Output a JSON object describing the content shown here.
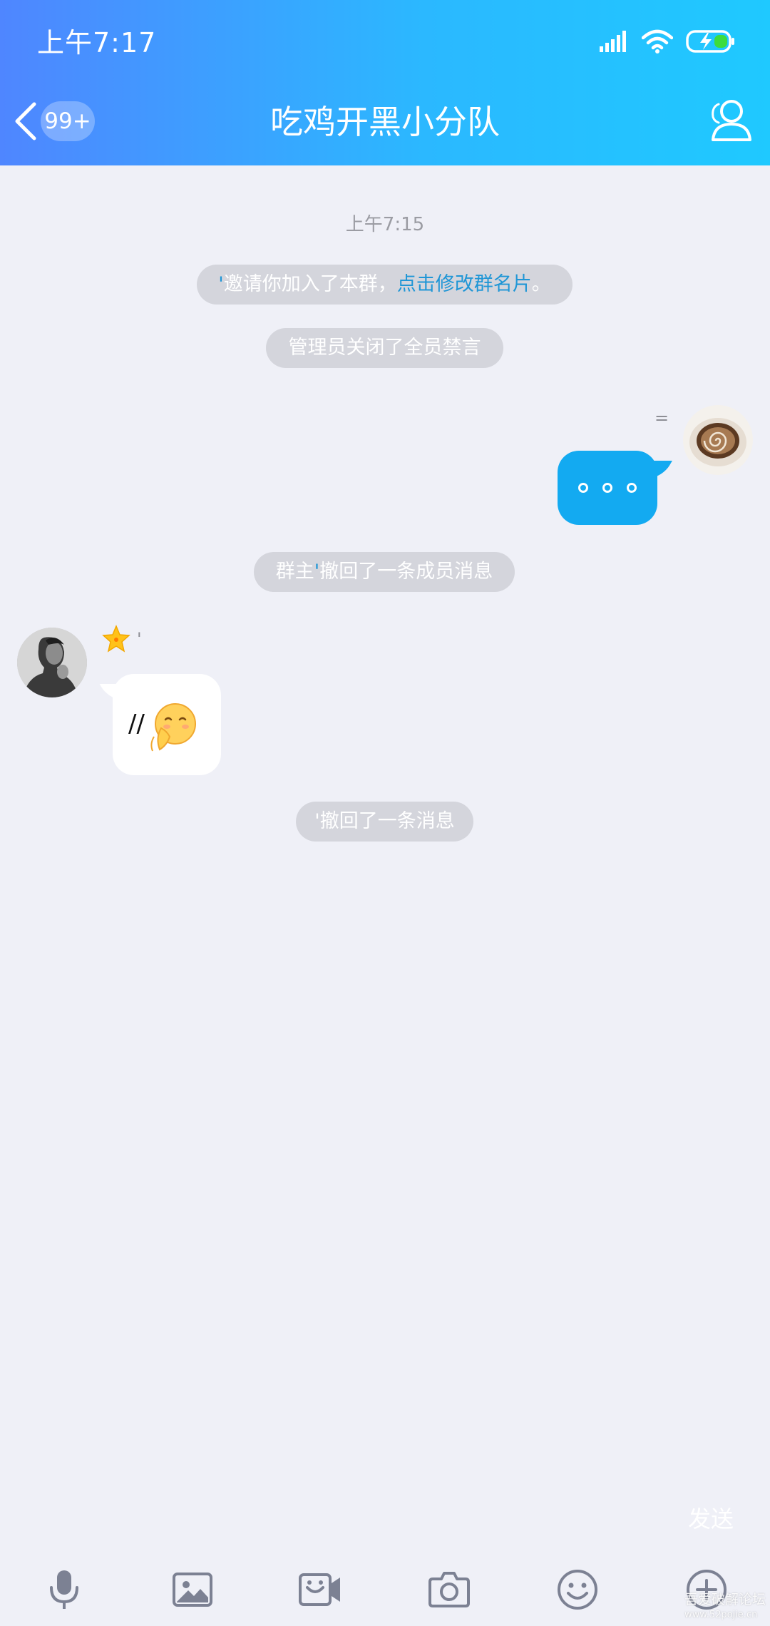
{
  "status_bar": {
    "time": "上午7:17",
    "icons": [
      "signal-icon",
      "wifi-icon",
      "battery-charging-icon"
    ]
  },
  "header": {
    "back_icon": "chevron-left-icon",
    "unread_count": "99+",
    "title": "吃鸡开黑小分队",
    "members_icon": "group-members-icon"
  },
  "chat": {
    "timestamp": "上午7:15",
    "system_messages": {
      "invite_prefix": "'",
      "invite_text": "邀请你加入了本群，",
      "invite_link": "点击修改群名片",
      "invite_suffix": "。",
      "mute_off": "管理员关闭了全员禁言",
      "owner_recall_prefix": "群主",
      "owner_recall_quote": "'",
      "owner_recall_text": "撤回了一条成员消息",
      "recall": "'撤回了一条消息"
    },
    "outgoing": {
      "nickname": "=",
      "avatar": "coffee-cup-avatar",
      "content": "..."
    },
    "incoming": {
      "nickname": "'",
      "badge": "star-badge-icon",
      "avatar": "man-portrait-avatar",
      "text": "//",
      "emoji": "pray-emoji-icon"
    }
  },
  "input": {
    "send_label": "发送"
  },
  "toolbar": {
    "items": [
      {
        "icon": "microphone-icon"
      },
      {
        "icon": "image-icon"
      },
      {
        "icon": "video-call-icon"
      },
      {
        "icon": "camera-icon"
      },
      {
        "icon": "emoji-icon"
      },
      {
        "icon": "plus-circle-icon"
      }
    ]
  },
  "watermark": {
    "line1": "吾爱破解论坛",
    "line2": "www.52pojie.cn"
  },
  "colors": {
    "header_start": "#4f86ff",
    "header_end": "#1fc9ff",
    "background": "#eff0f7",
    "outgoing_bubble": "#13aaf1",
    "system_pill": "#d4d5dc",
    "link": "#1f96d6",
    "toolbar_icon": "#7c8193"
  }
}
